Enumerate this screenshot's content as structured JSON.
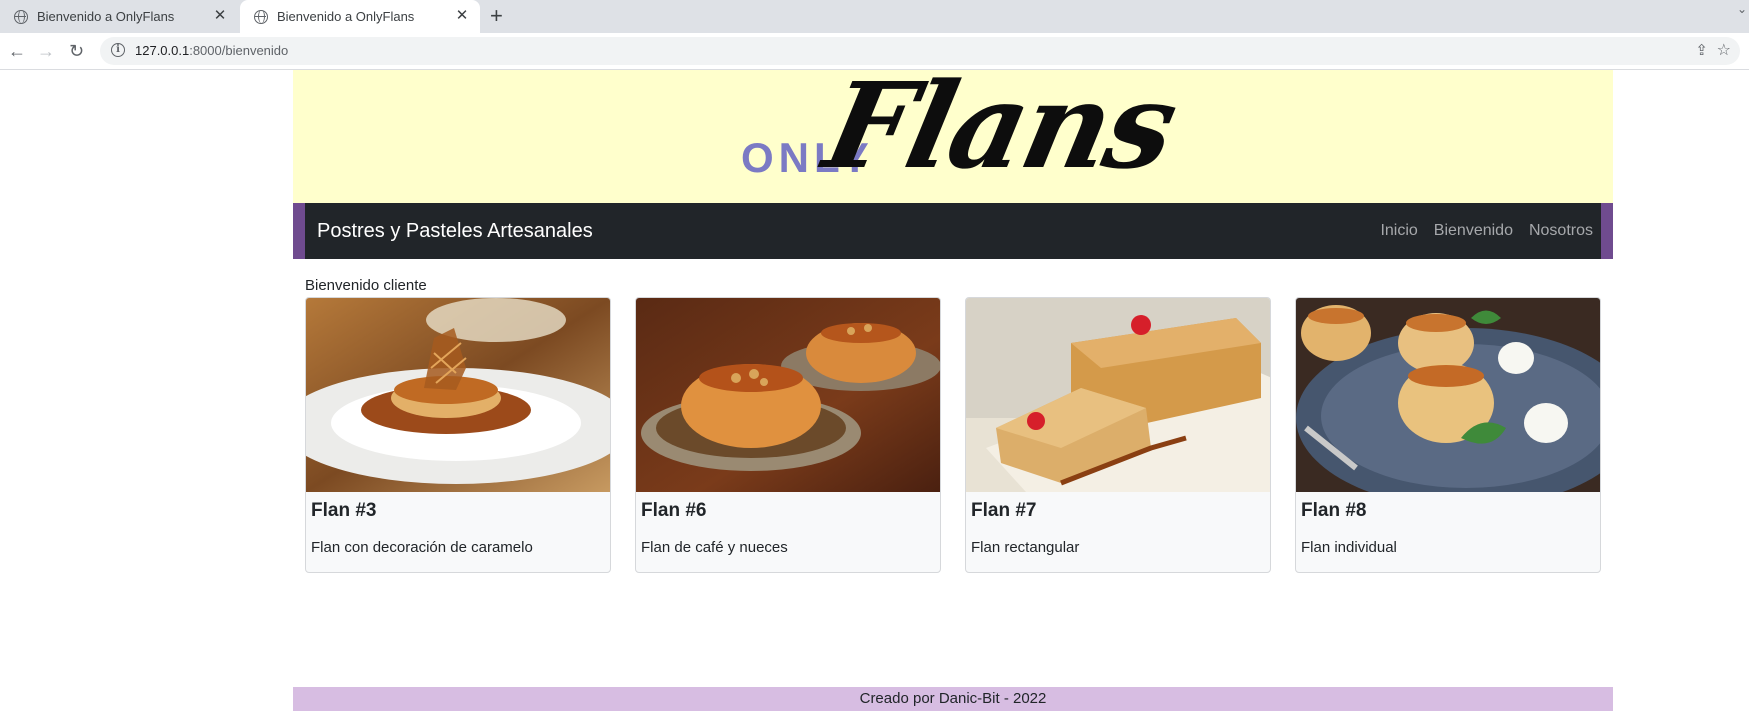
{
  "browser": {
    "tabs": [
      {
        "title": "Bienvenido a OnlyFlans",
        "active": false
      },
      {
        "title": "Bienvenido a OnlyFlans",
        "active": true
      }
    ],
    "url_host": "127.0.0.1",
    "url_path": ":8000/bienvenido"
  },
  "banner": {
    "logo_only": "ONLY",
    "logo_flans": "Flans",
    "background": "#ffffcc"
  },
  "navbar": {
    "brand": "Postres y Pasteles Artesanales",
    "links": [
      "Inicio",
      "Bienvenido",
      "Nosotros"
    ],
    "accent": "#6f4b8f"
  },
  "main": {
    "welcome": "Bienvenido cliente",
    "cards": [
      {
        "title": "Flan #3",
        "description": "Flan con decoración de caramelo"
      },
      {
        "title": "Flan #6",
        "description": "Flan de café y nueces"
      },
      {
        "title": "Flan #7",
        "description": "Flan rectangular"
      },
      {
        "title": "Flan #8",
        "description": "Flan individual"
      }
    ]
  },
  "footer": {
    "text": "Creado por Danic-Bit - 2022",
    "background": "#d7bde2"
  }
}
